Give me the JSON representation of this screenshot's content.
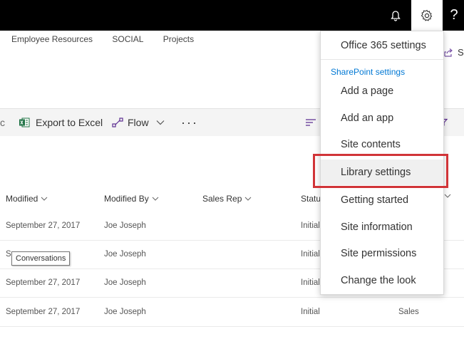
{
  "topbar": {
    "bell_icon": "bell-icon",
    "gear_icon": "gear-icon",
    "help_label": "?"
  },
  "nav": {
    "items": [
      "Employee Resources",
      "SOCIAL",
      "Projects"
    ]
  },
  "share": {
    "label": "S"
  },
  "commandbar": {
    "excel_label": "Export to Excel",
    "flow_label": "Flow",
    "more_label": "···",
    "c_label": "c"
  },
  "table": {
    "headers": [
      "Modified",
      "Modified By",
      "Sales Rep",
      "Statu",
      ""
    ],
    "rows": [
      [
        "September 27, 2017",
        "Joe Joseph",
        "",
        "Initial",
        ""
      ],
      [
        "S",
        "Joe Joseph",
        "",
        "Initial",
        ""
      ],
      [
        "September 27, 2017",
        "Joe Joseph",
        "",
        "Initial",
        ""
      ],
      [
        "September 27, 2017",
        "Joe Joseph",
        "",
        "Initial",
        "Sales"
      ]
    ]
  },
  "tooltip": {
    "text": "Conversations"
  },
  "settings_menu": {
    "office_label": "Office 365 settings",
    "section_title": "SharePoint settings",
    "items": [
      "Add a page",
      "Add an app",
      "Site contents",
      "Library settings",
      "Getting started",
      "Site information",
      "Site permissions",
      "Change the look"
    ]
  },
  "colors": {
    "accent": "#0078d4",
    "highlight": "#d13438",
    "topbar": "#000000"
  }
}
